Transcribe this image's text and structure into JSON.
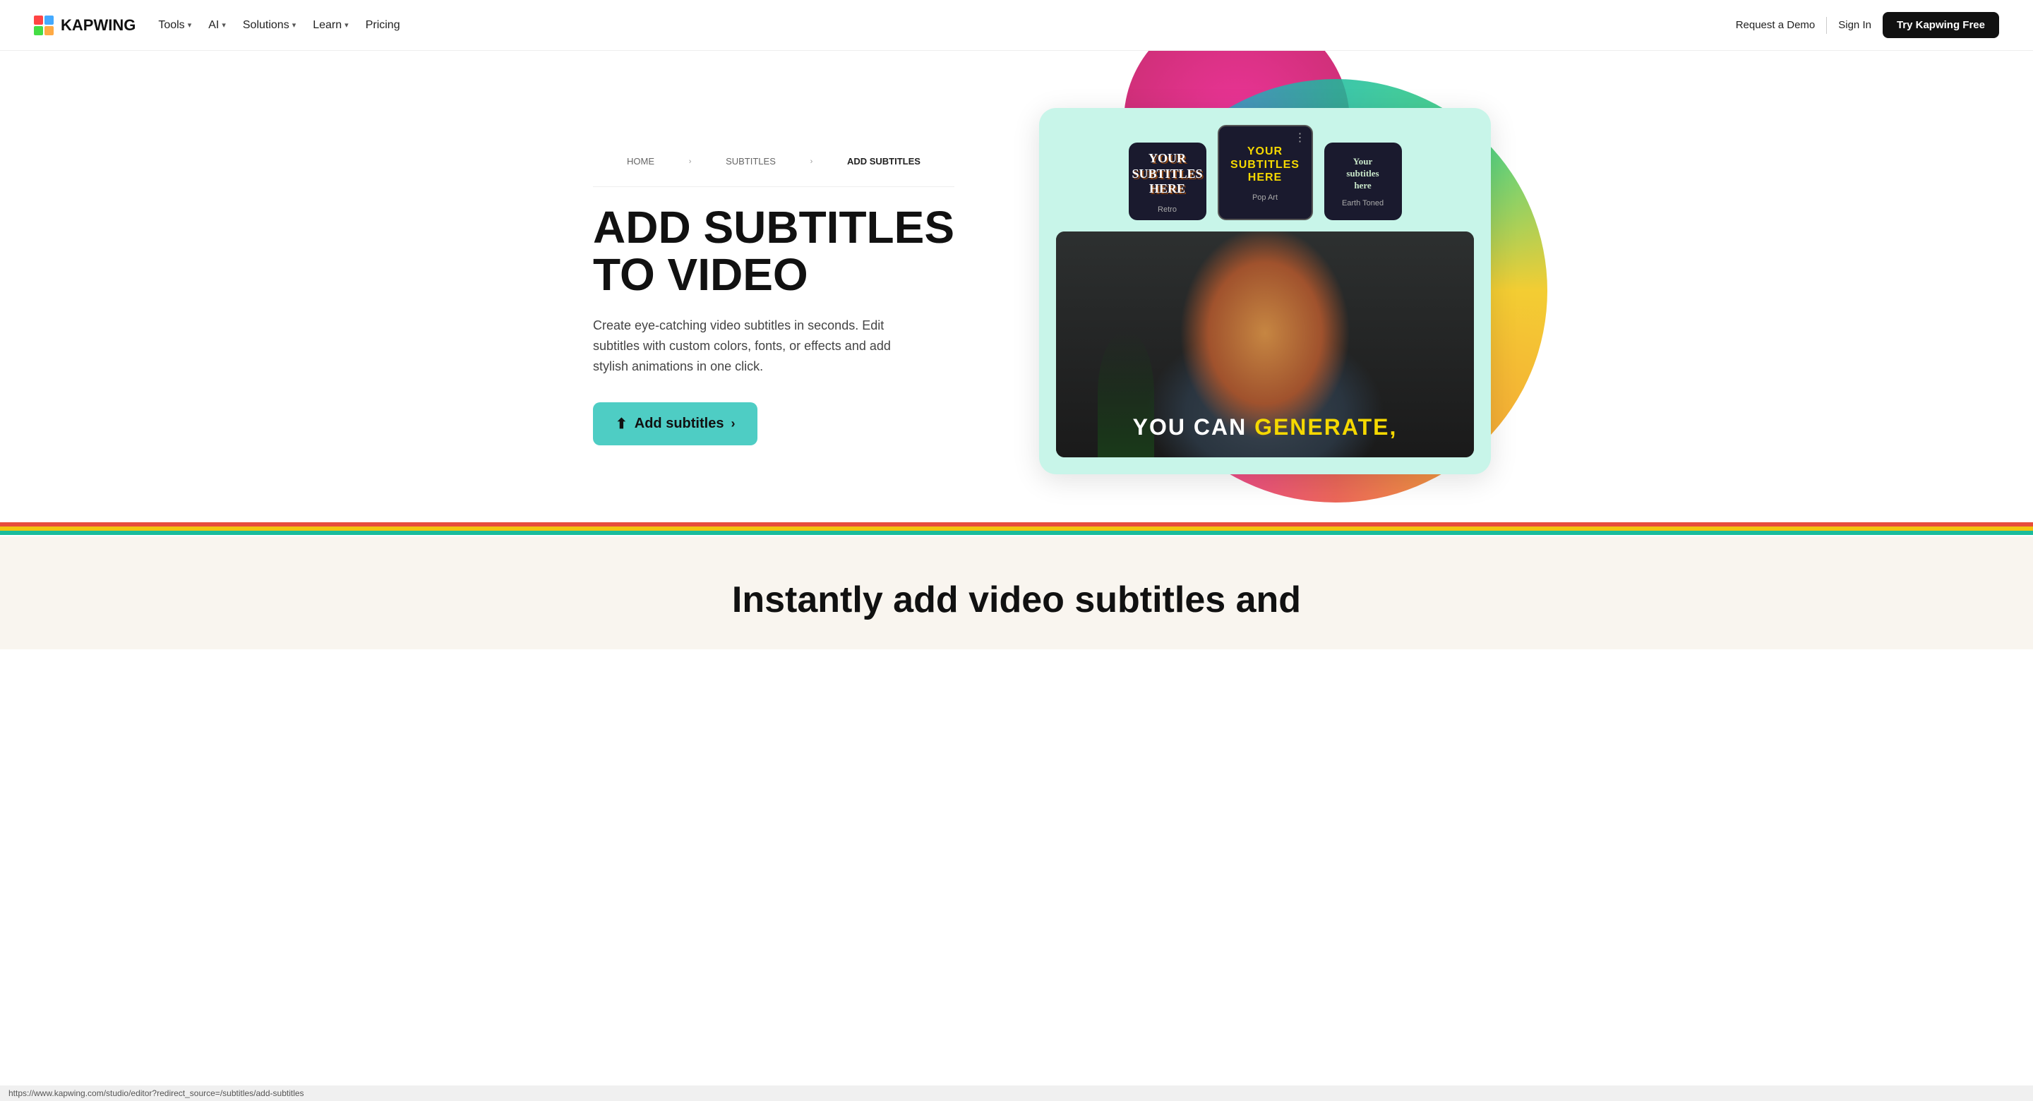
{
  "nav": {
    "logo_text": "KAPWING",
    "items": [
      {
        "label": "Tools",
        "has_dropdown": true
      },
      {
        "label": "AI",
        "has_dropdown": true
      },
      {
        "label": "Solutions",
        "has_dropdown": true
      },
      {
        "label": "Learn",
        "has_dropdown": true
      },
      {
        "label": "Pricing",
        "has_dropdown": false
      }
    ],
    "request_demo": "Request a Demo",
    "sign_in": "Sign In",
    "try_free": "Try Kapwing Free"
  },
  "breadcrumb": {
    "home": "HOME",
    "subtitles": "SUBTITLES",
    "current": "ADD SUBTITLES"
  },
  "hero": {
    "title_line1": "ADD SUBTITLES",
    "title_line2": "TO VIDEO",
    "description": "Create eye-catching video subtitles in seconds. Edit subtitles with custom colors, fonts, or effects and add stylish animations in one click.",
    "cta_label": "Add subtitles"
  },
  "style_cards": [
    {
      "id": "retro",
      "label": "Retro",
      "text_line1": "YOUR",
      "text_line2": "SUBTITLES",
      "text_line3": "HERE"
    },
    {
      "id": "popart",
      "label": "Pop Art",
      "text_line1": "YOUR",
      "text_line2": "SUBTITLES",
      "text_line3": "HERE",
      "selected": true
    },
    {
      "id": "earth",
      "label": "Earth Toned",
      "text_line1": "Your",
      "text_line2": "subtitles",
      "text_line3": "here"
    }
  ],
  "video": {
    "subtitle_normal": "YOU CAN ",
    "subtitle_highlight": "GENERATE,"
  },
  "bottom": {
    "heading_line1": "Instantly add video subtitles and"
  },
  "color_lines": [
    "#e74c3c",
    "#f1c40f",
    "#2ecc71",
    "#3498db"
  ],
  "status_bar": {
    "url": "https://www.kapwing.com/studio/editor?redirect_source=/subtitles/add-subtitles"
  }
}
